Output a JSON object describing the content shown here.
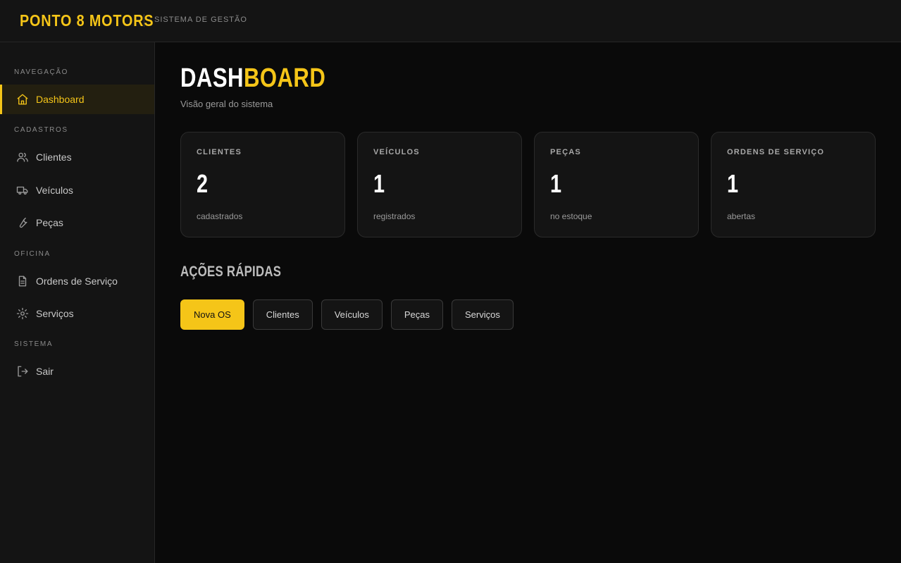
{
  "app": {
    "brand": "PONTO 8 MOTORS",
    "subtitle": "SISTEMA DE GESTÃO"
  },
  "colors": {
    "accent": "#f5c518",
    "background": "#0a0a0a",
    "panel": "#141414"
  },
  "sidebar": {
    "sections": [
      {
        "label": "NAVEGAÇÃO",
        "items": [
          {
            "label": "Dashboard",
            "icon": "home-icon",
            "active": true
          }
        ]
      },
      {
        "label": "CADASTROS",
        "items": [
          {
            "label": "Clientes",
            "icon": "users-icon"
          },
          {
            "label": "Veículos",
            "icon": "truck-icon"
          },
          {
            "label": "Peças",
            "icon": "wrench-icon"
          }
        ]
      },
      {
        "label": "OFICINA",
        "items": [
          {
            "label": "Ordens de Serviço",
            "icon": "file-icon"
          },
          {
            "label": "Serviços",
            "icon": "gear-icon"
          }
        ]
      },
      {
        "label": "SISTEMA",
        "items": [
          {
            "label": "Sair",
            "icon": "logout-icon"
          }
        ]
      }
    ]
  },
  "main": {
    "title_part1": "DASH",
    "title_part2": "BOARD",
    "subtitle": "Visão geral do sistema",
    "stats": [
      {
        "label": "CLIENTES",
        "value": "2",
        "note": "cadastrados"
      },
      {
        "label": "VEÍCULOS",
        "value": "1",
        "note": "registrados"
      },
      {
        "label": "PEÇAS",
        "value": "1",
        "note": "no estoque"
      },
      {
        "label": "ORDENS DE SERVIÇO",
        "value": "1",
        "note": "abertas"
      }
    ],
    "quick_actions_title": "AÇÕES RÁPIDAS",
    "quick_actions": [
      {
        "label": "Nova OS",
        "primary": true
      },
      {
        "label": "Clientes"
      },
      {
        "label": "Veículos"
      },
      {
        "label": "Peças"
      },
      {
        "label": "Serviços"
      }
    ]
  }
}
